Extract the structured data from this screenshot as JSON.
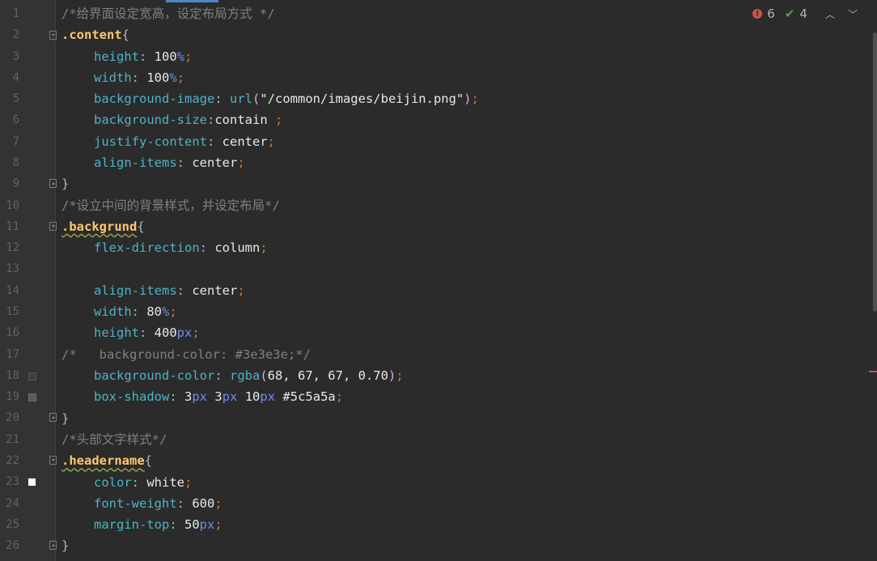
{
  "status": {
    "errors": "6",
    "warnings": "4"
  },
  "line_numbers": [
    "1",
    "2",
    "3",
    "4",
    "5",
    "6",
    "7",
    "8",
    "9",
    "10",
    "11",
    "12",
    "13",
    "14",
    "15",
    "16",
    "17",
    "18",
    "19",
    "20",
    "21",
    "22",
    "23",
    "24",
    "25",
    "26"
  ],
  "code": {
    "l1_comment": "/*给界面设定宽高，设定布局方式 */",
    "l2_selector": ".content",
    "l3_prop": "height",
    "l3_num": "100",
    "l3_unit": "%",
    "l4_prop": "width",
    "l4_num": "100",
    "l4_unit": "%",
    "l5_prop": "background-image",
    "l5_fn": "url",
    "l5_str": "\"/common/images/beijin.png\"",
    "l6_prop": "background-size",
    "l6_val": "contain",
    "l7_prop": "justify-content",
    "l7_val": "center",
    "l8_prop": "align-items",
    "l8_val": "center",
    "l10_comment": "/*设立中间的背景样式，并设定布局*/",
    "l11_selector": ".backgrund",
    "l12_prop": "flex-direction",
    "l12_val": "column",
    "l14_prop": "align-items",
    "l14_val": "center",
    "l15_prop": "width",
    "l15_num": "80",
    "l15_unit": "%",
    "l16_prop": "height",
    "l16_num": "400",
    "l16_unit": "px",
    "l17_comment": "/*   background-color: #3e3e3e;*/",
    "l18_prop": "background-color",
    "l18_fn": "rgba",
    "l18_args": "68, 67, 67, 0.70",
    "l19_prop": "box-shadow",
    "l19_n1": "3",
    "l19_u1": "px",
    "l19_n2": "3",
    "l19_u2": "px",
    "l19_n3": "10",
    "l19_u3": "px",
    "l19_color": "#5c5a5a",
    "l21_comment": "/*头部文字样式*/",
    "l22_selector": ".headername",
    "l23_prop": "color",
    "l23_val": "white",
    "l24_prop": "font-weight",
    "l24_val": "600",
    "l25_prop": "margin-top",
    "l25_num": "50",
    "l25_unit": "px"
  }
}
